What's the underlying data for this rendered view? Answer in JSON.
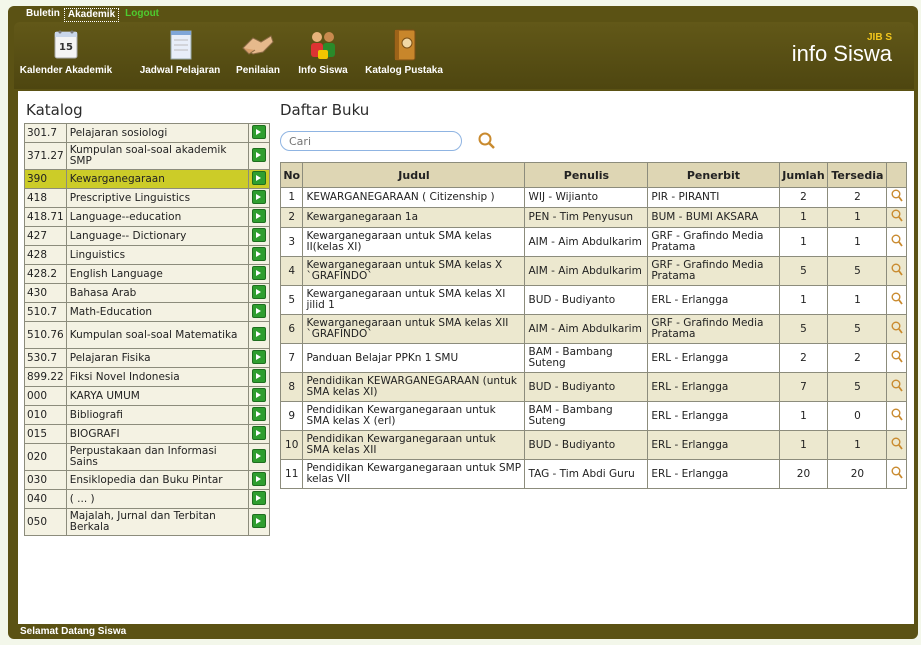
{
  "menu": {
    "buletin": "Buletin",
    "akademik": "Akademik",
    "logout": "Logout"
  },
  "toolbar": {
    "items": [
      {
        "label": "Kalender Akademik",
        "icon": "calendar-icon",
        "day": "15"
      },
      {
        "label": "Jadwal Pelajaran",
        "icon": "notepad-icon"
      },
      {
        "label": "Penilaian",
        "icon": "handshake-icon"
      },
      {
        "label": "Info Siswa",
        "icon": "students-icon"
      },
      {
        "label": "Katalog Pustaka",
        "icon": "book-icon"
      }
    ]
  },
  "brand": {
    "jibas": "JIB  S",
    "name": "info Siswa"
  },
  "catalog": {
    "title": "Katalog",
    "items": [
      {
        "code": "301.7",
        "name": "Pelajaran sosiologi"
      },
      {
        "code": "371.27",
        "name": "Kumpulan soal-soal akademik SMP"
      },
      {
        "code": "390",
        "name": "Kewarganegaraan"
      },
      {
        "code": "418",
        "name": "Prescriptive Linguistics"
      },
      {
        "code": "418.71",
        "name": "Language--education"
      },
      {
        "code": "427",
        "name": "Language-- Dictionary"
      },
      {
        "code": "428",
        "name": "Linguistics"
      },
      {
        "code": "428.2",
        "name": "English Language"
      },
      {
        "code": "430",
        "name": "Bahasa Arab"
      },
      {
        "code": "510.7",
        "name": "Math-Education"
      },
      {
        "code": "510.76",
        "name": "Kumpulan soal-soal Matematika"
      },
      {
        "code": "530.7",
        "name": "Pelajaran Fisika"
      },
      {
        "code": "899.22",
        "name": "Fiksi Novel Indonesia"
      },
      {
        "code": "000",
        "name": "KARYA UMUM"
      },
      {
        "code": "010",
        "name": "Bibliografi"
      },
      {
        "code": "015",
        "name": "BIOGRAFI"
      },
      {
        "code": "020",
        "name": "Perpustakaan dan Informasi Sains"
      },
      {
        "code": "030",
        "name": "Ensiklopedia dan Buku Pintar"
      },
      {
        "code": "040",
        "name": "( ... )"
      },
      {
        "code": "050",
        "name": "Majalah, Jurnal dan Terbitan Berkala"
      }
    ],
    "selected_index": 2
  },
  "books": {
    "title": "Daftar Buku",
    "search_placeholder": "Cari",
    "columns": [
      "No",
      "Judul",
      "Penulis",
      "Penerbit",
      "Jumlah",
      "Tersedia"
    ],
    "rows": [
      {
        "no": "1",
        "judul": "KEWARGANEGARAAN ( Citizenship )",
        "penulis": "WIJ - Wijianto",
        "penerbit": "PIR - PIRANTI",
        "jumlah": "2",
        "tersedia": "2"
      },
      {
        "no": "2",
        "judul": "Kewarganegaraan 1a",
        "penulis": "PEN - Tim Penyusun",
        "penerbit": "BUM - BUMI AKSARA",
        "jumlah": "1",
        "tersedia": "1"
      },
      {
        "no": "3",
        "judul": "Kewarganegaraan untuk SMA kelas II(kelas XI)",
        "penulis": "AIM - Aim Abdulkarim",
        "penerbit": "GRF - Grafindo Media Pratama",
        "jumlah": "1",
        "tersedia": "1"
      },
      {
        "no": "4",
        "judul": "Kewarganegaraan untuk SMA kelas X `GRAFINDO`",
        "penulis": "AIM - Aim Abdulkarim",
        "penerbit": "GRF - Grafindo Media Pratama",
        "jumlah": "5",
        "tersedia": "5"
      },
      {
        "no": "5",
        "judul": "Kewarganegaraan untuk SMA kelas XI jilid 1",
        "penulis": "BUD - Budiyanto",
        "penerbit": "ERL - Erlangga",
        "jumlah": "1",
        "tersedia": "1"
      },
      {
        "no": "6",
        "judul": "Kewarganegaraan untuk SMA kelas XII `GRAFINDO`",
        "penulis": "AIM - Aim Abdulkarim",
        "penerbit": "GRF - Grafindo Media Pratama",
        "jumlah": "5",
        "tersedia": "5"
      },
      {
        "no": "7",
        "judul": "Panduan Belajar PPKn 1 SMU",
        "penulis": "BAM - Bambang Suteng",
        "penerbit": "ERL - Erlangga",
        "jumlah": "2",
        "tersedia": "2"
      },
      {
        "no": "8",
        "judul": "Pendidikan KEWARGANEGARAAN (untuk SMA kelas XI)",
        "penulis": "BUD - Budiyanto",
        "penerbit": "ERL - Erlangga",
        "jumlah": "7",
        "tersedia": "5"
      },
      {
        "no": "9",
        "judul": "Pendidikan Kewarganegaraan untuk SMA kelas X (erl)",
        "penulis": "BAM - Bambang Suteng",
        "penerbit": "ERL - Erlangga",
        "jumlah": "1",
        "tersedia": "0"
      },
      {
        "no": "10",
        "judul": "Pendidikan Kewarganegaraan untuk SMA kelas XII",
        "penulis": "BUD - Budiyanto",
        "penerbit": "ERL - Erlangga",
        "jumlah": "1",
        "tersedia": "1"
      },
      {
        "no": "11",
        "judul": "Pendidikan Kewarganegaraan untuk SMP kelas VII",
        "penulis": "TAG - Tim Abdi Guru",
        "penerbit": "ERL - Erlangga",
        "jumlah": "20",
        "tersedia": "20"
      }
    ]
  },
  "footer": "Selamat Datang Siswa",
  "colors": {
    "frame": "#5b5214",
    "selected_row": "#cccc28",
    "alt_row": "#ece8cf",
    "header_row": "#ded6b4",
    "go_button": "#2f9e2f",
    "logout": "#4ecb2f"
  }
}
